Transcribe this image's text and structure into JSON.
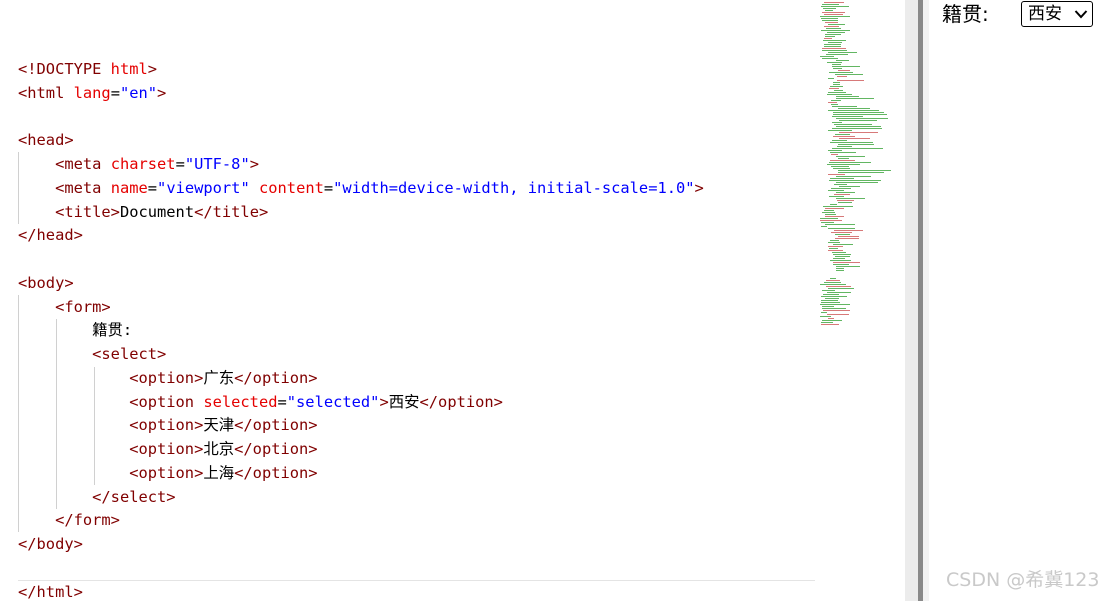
{
  "editor": {
    "lines": [
      [
        {
          "t": "tag",
          "s": "<!DOCTYPE "
        },
        {
          "t": "attr",
          "s": "html"
        },
        {
          "t": "tag",
          "s": ">"
        }
      ],
      [
        {
          "t": "tag",
          "s": "<html "
        },
        {
          "t": "attr",
          "s": "lang"
        },
        {
          "t": "txt",
          "s": "="
        },
        {
          "t": "val",
          "s": "\"en\""
        },
        {
          "t": "tag",
          "s": ">"
        }
      ],
      [],
      [
        {
          "t": "tag",
          "s": "<head>"
        }
      ],
      [
        {
          "t": "txt",
          "s": "    "
        },
        {
          "t": "tag",
          "s": "<meta "
        },
        {
          "t": "attr",
          "s": "charset"
        },
        {
          "t": "txt",
          "s": "="
        },
        {
          "t": "val",
          "s": "\"UTF-8\""
        },
        {
          "t": "tag",
          "s": ">"
        }
      ],
      [
        {
          "t": "txt",
          "s": "    "
        },
        {
          "t": "tag",
          "s": "<meta "
        },
        {
          "t": "attr",
          "s": "name"
        },
        {
          "t": "txt",
          "s": "="
        },
        {
          "t": "val",
          "s": "\"viewport\""
        },
        {
          "t": "txt",
          "s": " "
        },
        {
          "t": "attr",
          "s": "content"
        },
        {
          "t": "txt",
          "s": "="
        },
        {
          "t": "val",
          "s": "\"width=device-width, initial-scale=1.0\""
        },
        {
          "t": "tag",
          "s": ">"
        }
      ],
      [
        {
          "t": "txt",
          "s": "    "
        },
        {
          "t": "tag",
          "s": "<title>"
        },
        {
          "t": "txt",
          "s": "Document"
        },
        {
          "t": "tag",
          "s": "</title>"
        }
      ],
      [
        {
          "t": "tag",
          "s": "</head>"
        }
      ],
      [],
      [
        {
          "t": "tag",
          "s": "<body>"
        }
      ],
      [
        {
          "t": "txt",
          "s": "    "
        },
        {
          "t": "tag",
          "s": "<form>"
        }
      ],
      [
        {
          "t": "txt",
          "s": "        籍贯:"
        }
      ],
      [
        {
          "t": "txt",
          "s": "        "
        },
        {
          "t": "tag",
          "s": "<select>"
        }
      ],
      [
        {
          "t": "txt",
          "s": "            "
        },
        {
          "t": "tag",
          "s": "<option>"
        },
        {
          "t": "txt",
          "s": "广东"
        },
        {
          "t": "tag",
          "s": "</option>"
        }
      ],
      [
        {
          "t": "txt",
          "s": "            "
        },
        {
          "t": "tag",
          "s": "<option "
        },
        {
          "t": "attr",
          "s": "selected"
        },
        {
          "t": "txt",
          "s": "="
        },
        {
          "t": "val",
          "s": "\"selected\""
        },
        {
          "t": "tag",
          "s": ">"
        },
        {
          "t": "txt",
          "s": "西安"
        },
        {
          "t": "tag",
          "s": "</option>"
        }
      ],
      [
        {
          "t": "txt",
          "s": "            "
        },
        {
          "t": "tag",
          "s": "<option>"
        },
        {
          "t": "txt",
          "s": "天津"
        },
        {
          "t": "tag",
          "s": "</option>"
        }
      ],
      [
        {
          "t": "txt",
          "s": "            "
        },
        {
          "t": "tag",
          "s": "<option>"
        },
        {
          "t": "txt",
          "s": "北京"
        },
        {
          "t": "tag",
          "s": "</option>"
        }
      ],
      [
        {
          "t": "txt",
          "s": "            "
        },
        {
          "t": "tag",
          "s": "<option>"
        },
        {
          "t": "txt",
          "s": "上海"
        },
        {
          "t": "tag",
          "s": "</option>"
        }
      ],
      [
        {
          "t": "txt",
          "s": "        "
        },
        {
          "t": "tag",
          "s": "</select>"
        }
      ],
      [
        {
          "t": "txt",
          "s": "    "
        },
        {
          "t": "tag",
          "s": "</form>"
        }
      ],
      [
        {
          "t": "tag",
          "s": "</body>"
        }
      ],
      [],
      [
        {
          "t": "tag",
          "s": "</html>"
        }
      ]
    ]
  },
  "preview": {
    "label": "籍贯:",
    "select_value": "西安"
  },
  "watermark": "CSDN @希冀123",
  "colors": {
    "tag": "#800000",
    "attr": "#e50000",
    "value": "#0000ff",
    "minimap_green": "#2e9e2e"
  }
}
